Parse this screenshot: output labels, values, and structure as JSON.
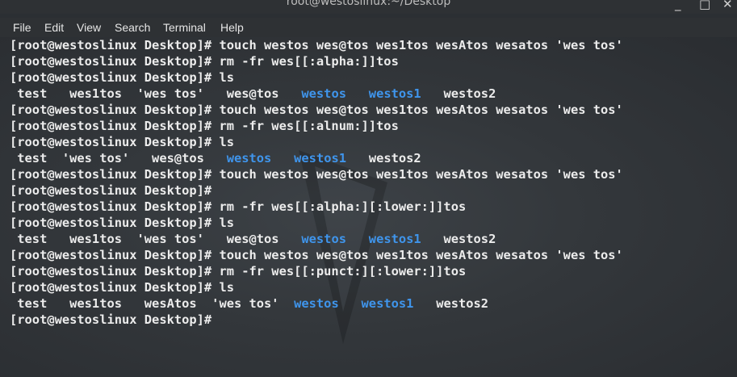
{
  "window": {
    "title": "root@westoslinux:~/Desktop"
  },
  "menubar": {
    "items": [
      "File",
      "Edit",
      "View",
      "Search",
      "Terminal",
      "Help"
    ]
  },
  "terminal": {
    "lines": [
      [
        {
          "t": "[root@westoslinux Desktop]# touch westos wes@tos wes1tos wesAtos wesatos 'wes tos'"
        }
      ],
      [
        {
          "t": "[root@westoslinux Desktop]# rm -fr wes[[:alpha:]]tos"
        }
      ],
      [
        {
          "t": "[root@westoslinux Desktop]# ls"
        }
      ],
      [
        {
          "t": " test   wes1tos  'wes tos'   wes@tos   "
        },
        {
          "t": "westos",
          "c": "dir"
        },
        {
          "t": "   "
        },
        {
          "t": "westos1",
          "c": "dir"
        },
        {
          "t": "   westos2"
        }
      ],
      [
        {
          "t": "[root@westoslinux Desktop]# touch westos wes@tos wes1tos wesAtos wesatos 'wes tos'"
        }
      ],
      [
        {
          "t": "[root@westoslinux Desktop]# rm -fr wes[[:alnum:]]tos"
        }
      ],
      [
        {
          "t": "[root@westoslinux Desktop]# ls"
        }
      ],
      [
        {
          "t": " test  'wes tos'   wes@tos   "
        },
        {
          "t": "westos",
          "c": "dir"
        },
        {
          "t": "   "
        },
        {
          "t": "westos1",
          "c": "dir"
        },
        {
          "t": "   westos2"
        }
      ],
      [
        {
          "t": "[root@westoslinux Desktop]# touch westos wes@tos wes1tos wesAtos wesatos 'wes tos'"
        }
      ],
      [
        {
          "t": "[root@westoslinux Desktop]#"
        }
      ],
      [
        {
          "t": "[root@westoslinux Desktop]# rm -fr wes[[:alpha:][:lower:]]tos"
        }
      ],
      [
        {
          "t": "[root@westoslinux Desktop]# ls"
        }
      ],
      [
        {
          "t": " test   wes1tos  'wes tos'   wes@tos   "
        },
        {
          "t": "westos",
          "c": "dir"
        },
        {
          "t": "   "
        },
        {
          "t": "westos1",
          "c": "dir"
        },
        {
          "t": "   westos2"
        }
      ],
      [
        {
          "t": "[root@westoslinux Desktop]# touch westos wes@tos wes1tos wesAtos wesatos 'wes tos'"
        }
      ],
      [
        {
          "t": "[root@westoslinux Desktop]# rm -fr wes[[:punct:][:lower:]]tos"
        }
      ],
      [
        {
          "t": "[root@westoslinux Desktop]# ls"
        }
      ],
      [
        {
          "t": " test   wes1tos   wesAtos  'wes tos'  "
        },
        {
          "t": "westos",
          "c": "dir"
        },
        {
          "t": "   "
        },
        {
          "t": "westos1",
          "c": "dir"
        },
        {
          "t": "   westos2"
        }
      ],
      [
        {
          "t": "[root@westoslinux Desktop]#"
        }
      ]
    ]
  },
  "colors": {
    "directory": "#3f95ec",
    "text": "#ececec",
    "background": "#33373b"
  }
}
